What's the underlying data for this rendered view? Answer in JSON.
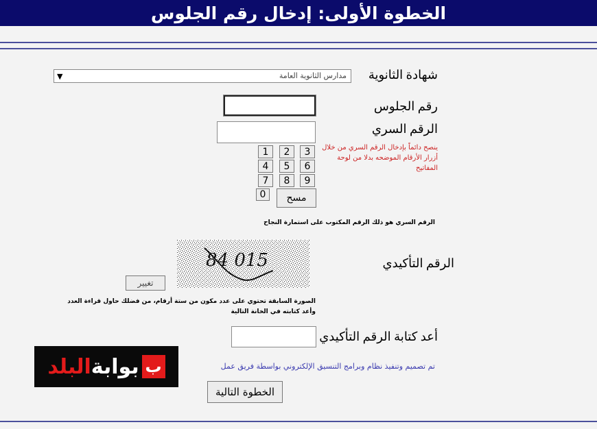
{
  "header": {
    "title": "الخطوة الأولى: إدخال رقم الجلوس"
  },
  "form": {
    "certificate_label": "شهادة الثانوية",
    "certificate_selected": "مدارس الثانوية العامة",
    "seat_label": "رقم الجلوس",
    "seat_value": "",
    "password_label": "الرقم السري",
    "password_value": "",
    "keypad": {
      "keys": [
        "1",
        "2",
        "3",
        "4",
        "5",
        "6",
        "7",
        "8",
        "9",
        "0"
      ],
      "clear_label": "مسح"
    },
    "keypad_note": "ينصح دائماً بإدخال الرقم السري من خلال أزرار الأرقام الموضحه بدلا من لوحة المفاتيح",
    "password_hint": "الرقم السري هو ذلك الرقم المكتوب على استمارة النجاح",
    "captcha_label": "الرقم التأكيدي",
    "captcha_text": "84 015",
    "change_label": "تغيير",
    "captcha_note_1": "الصورة السابقة تحتوي على عدد مكون من ستة أرقام، من فضلك حاول قراءة العدد",
    "captcha_note_2": "وأعد كتابته في الخانة التالية",
    "captcha_confirm_label": "أعد كتابة الرقم التأكيدي",
    "captcha_confirm_value": "",
    "credit": "تم تصميم وتنفيذ نظام وبرامج التنسيق الإلكتروني بواسطة فريق عمل",
    "next_label": "الخطوة التالية"
  },
  "logo": {
    "part1": "بوابة",
    "part2": "البلد",
    "mark": "ب"
  },
  "colors": {
    "header_bg": "#0b0b6b",
    "rule": "#4a4f9b",
    "note_red": "#c22222",
    "credit_blue": "#3b3bb0"
  }
}
